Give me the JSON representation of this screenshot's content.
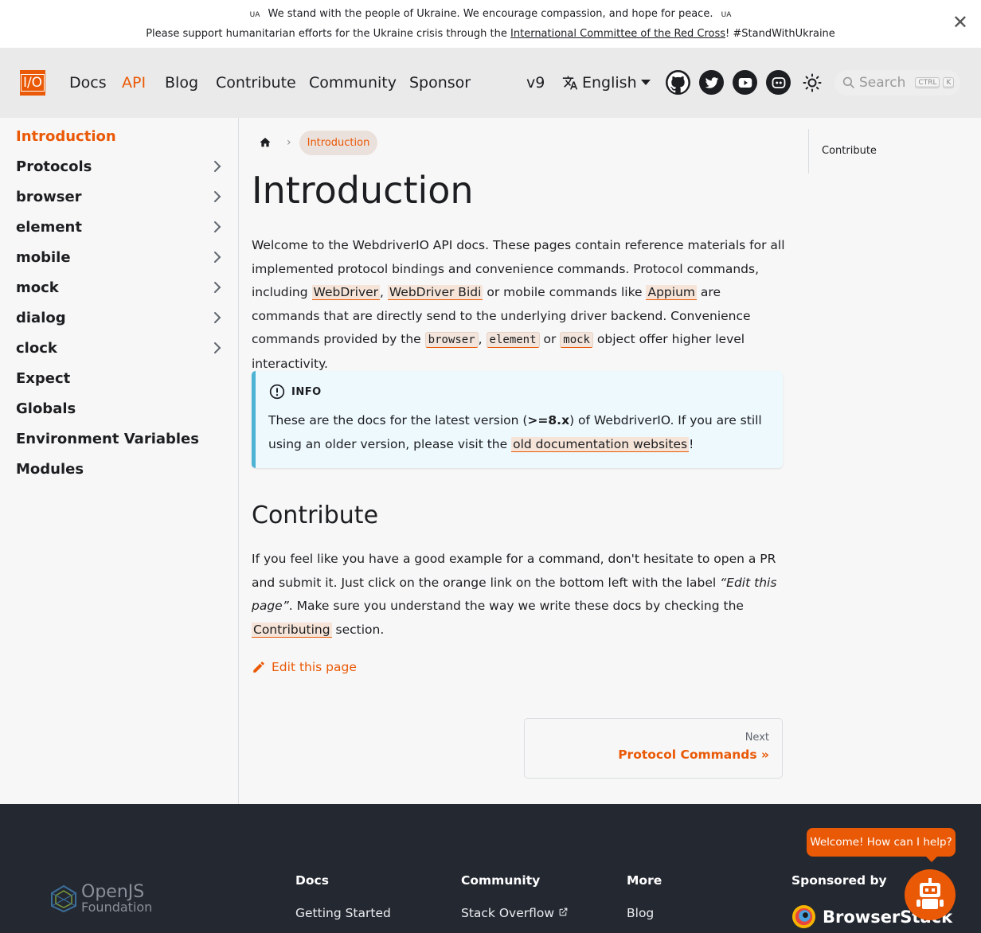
{
  "announcement": {
    "ua_left": "UA",
    "line1": "We stand with the people of Ukraine. We encourage compassion, and hope for peace.",
    "ua_right": "UA",
    "line2_prefix": "Please support humanitarian efforts for the Ukraine crisis through the ",
    "line2_link": "International Committee of the Red Cross",
    "line2_suffix": "! #StandWithUkraine",
    "close": "✕"
  },
  "navbar": {
    "logo": "I/O",
    "links": [
      "Docs",
      "API",
      "Blog",
      "Contribute",
      "Community",
      "Sponsor"
    ],
    "active_link": "API",
    "version": "v9",
    "language": "English",
    "search_placeholder": "Search",
    "search_kbd": [
      "CTRL",
      "K"
    ],
    "social_icons": [
      "github-icon",
      "twitter-icon",
      "youtube-icon",
      "discord-icon"
    ]
  },
  "sidebar": {
    "items": [
      {
        "label": "Introduction",
        "expandable": false,
        "active": true
      },
      {
        "label": "Protocols",
        "expandable": true
      },
      {
        "label": "browser",
        "expandable": true
      },
      {
        "label": "element",
        "expandable": true
      },
      {
        "label": "mobile",
        "expandable": true
      },
      {
        "label": "mock",
        "expandable": true
      },
      {
        "label": "dialog",
        "expandable": true
      },
      {
        "label": "clock",
        "expandable": true
      },
      {
        "label": "Expect",
        "expandable": false
      },
      {
        "label": "Globals",
        "expandable": false
      },
      {
        "label": "Environment Variables",
        "expandable": false
      },
      {
        "label": "Modules",
        "expandable": false
      }
    ]
  },
  "breadcrumb": {
    "current": "Introduction"
  },
  "main": {
    "title": "Introduction",
    "intro": {
      "t1": "Welcome to the WebdriverIO API docs. These pages contain reference materials for all implemented protocol bindings and convenience commands. Protocol commands, including ",
      "link1": "WebDriver",
      "t2": ", ",
      "link2": "WebDriver Bidi",
      "t3": " or mobile commands like ",
      "link3": "Appium",
      "t4": " are commands that are directly send to the underlying driver backend. Convenience commands provided by the ",
      "code1": "browser",
      "t5": ", ",
      "code2": "element",
      "t6": " or ",
      "code3": "mock",
      "t7": " object offer higher level interactivity."
    },
    "info": {
      "heading": "INFO",
      "t1": "These are the docs for the latest version (",
      "bold": ">=8.x",
      "t2": ") of WebdriverIO. If you are still using an older version, please visit the ",
      "link": "old documentation websites",
      "t3": "!"
    },
    "contribute_heading": "Contribute",
    "contribute": {
      "t1": "If you feel like you have a good example for a command, don't hesitate to open a PR and submit it. Just click on the orange link on the bottom left with the label ",
      "italic": "“Edit this page”",
      "t2": ". Make sure you understand the way we write these docs by checking the ",
      "link": "Contributing",
      "t3": " section."
    },
    "edit_link": "Edit this page",
    "next_label": "Next",
    "next_target": "Protocol Commands »"
  },
  "toc": {
    "items": [
      "Contribute"
    ]
  },
  "footer": {
    "org_name_1": "OpenJS",
    "org_name_2": "Foundation",
    "columns": [
      {
        "title": "Docs",
        "link": "Getting Started"
      },
      {
        "title": "Community",
        "link": "Stack Overflow"
      },
      {
        "title": "More",
        "link": "Blog"
      },
      {
        "title": "Sponsored by",
        "link": ""
      }
    ],
    "sponsor": "BrowserStack"
  },
  "chat": {
    "bubble": "Welcome! How can I help?"
  },
  "colors": {
    "accent": "#ea5906",
    "info_border": "#4cb3d4",
    "footer_bg": "#242831"
  }
}
